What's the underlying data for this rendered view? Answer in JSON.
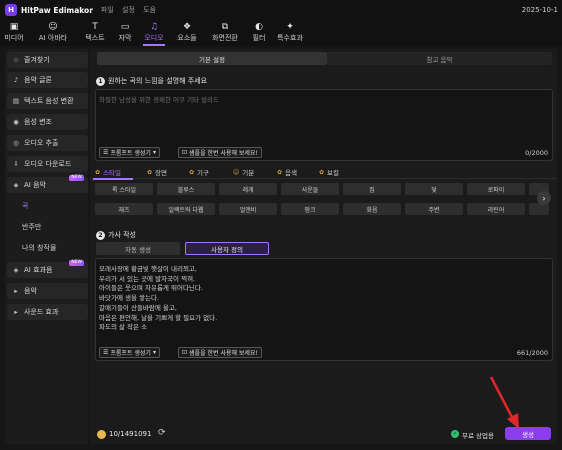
{
  "app": {
    "logo_letter": "H",
    "name": "HitPaw Edimakor",
    "menu": [
      "파일",
      "설정",
      "도움"
    ],
    "date": "2025-10-1"
  },
  "toolbar": [
    {
      "label": "미디어",
      "icon": "media-icon",
      "glyph": "▣"
    },
    {
      "label": "AI 아바타",
      "icon": "avatar-icon",
      "glyph": "☺"
    },
    {
      "label": "텍스트",
      "icon": "text-icon",
      "glyph": "T"
    },
    {
      "label": "자막",
      "icon": "subtitle-icon",
      "glyph": "▭"
    },
    {
      "label": "오디오",
      "icon": "audio-icon",
      "glyph": "♫"
    },
    {
      "label": "요소들",
      "icon": "elements-icon",
      "glyph": "❖"
    },
    {
      "label": "화면전환",
      "icon": "transition-icon",
      "glyph": "⧉"
    },
    {
      "label": "필터",
      "icon": "filter-icon",
      "glyph": "◐"
    },
    {
      "label": "특수효과",
      "icon": "effects-icon",
      "glyph": "✦"
    }
  ],
  "sidebar": {
    "items": [
      {
        "label": "즐겨찾기",
        "icon": "star-icon",
        "glyph": "☆"
      },
      {
        "label": "음악 글론",
        "icon": "music-icon",
        "glyph": "♪"
      },
      {
        "label": "텍스트 음성 변환",
        "icon": "tts-icon",
        "glyph": "▤"
      },
      {
        "label": "음성 변조",
        "icon": "voice-icon",
        "glyph": "◉"
      },
      {
        "label": "오디오 추출",
        "icon": "extract-icon",
        "glyph": "◎"
      },
      {
        "label": "오디오 다운로드",
        "icon": "download-icon",
        "glyph": "⇩"
      },
      {
        "label": "AI 음악",
        "icon": "ai-music-icon",
        "glyph": "◈",
        "badge": "NEW"
      },
      {
        "label": "곡"
      },
      {
        "label": "반주만"
      },
      {
        "label": "나의 창작물"
      },
      {
        "label": "AI 효과음",
        "icon": "ai-sfx-icon",
        "glyph": "◈",
        "badge": "NEW"
      },
      {
        "label": "음악",
        "icon": "caret-right-icon",
        "glyph": "▸"
      },
      {
        "label": "사운드 효과",
        "icon": "caret-right-icon",
        "glyph": "▸"
      }
    ]
  },
  "mode_tabs": [
    "기본 설정",
    "참고 음악"
  ],
  "section1": {
    "number": "1",
    "title": "원하는 곡의 느낌을 설명해 주세요",
    "placeholder": "좌절한 남성을 위한 경쾌한 어쿠 기타 발라드",
    "prompt_button": "프롬프트 생성기",
    "sample_button": "샘플을 한번 사용해 보세요!",
    "counter": "0/2000"
  },
  "style_tabs": [
    {
      "label": "스타일",
      "glyph": "✿"
    },
    {
      "label": "장면",
      "glyph": "✿"
    },
    {
      "label": "기구",
      "glyph": "✿"
    },
    {
      "label": "기분",
      "glyph": "☺"
    },
    {
      "label": "음색",
      "glyph": "✿"
    },
    {
      "label": "보컬",
      "glyph": "✿"
    }
  ],
  "genre_rows": [
    [
      "록 스타일",
      "블루스",
      "레게",
      "사운들",
      "집",
      "덫",
      "로파이"
    ],
    [
      "재즈",
      "일렉트릭 다웹",
      "얼앤비",
      "펑크",
      "화음",
      "주변",
      "라틴어"
    ]
  ],
  "section2": {
    "number": "2",
    "title": "가사 작성",
    "tabs": [
      "자동 생성",
      "사용자 정의"
    ],
    "lyrics": [
      "모래사장에 황금빛 햇살이 내리쬐고,",
      "우리가 서 있는 곳에 발자국이 찍혀.",
      "아이들은 웃으며 자유롭게 뛰어다닌다.",
      "바닷가에 생을 쌓는다.",
      "갈매기들이 산들바람에 울고,",
      "마음은 편안해, 날을 기쁘게 할 필요가 없다.",
      "파도의 삶 작은 소"
    ],
    "prompt_button": "프롬프트 생성기",
    "sample_button": "샘플을 한번 사용해 보세요!",
    "counter": "661/2000"
  },
  "footer": {
    "credits": "10/1491091",
    "commercial": "무료 상업용",
    "generate": "생성"
  },
  "colors": {
    "accent": "#a874ff",
    "button": "#8b3df0",
    "arrow": "#e02828"
  }
}
